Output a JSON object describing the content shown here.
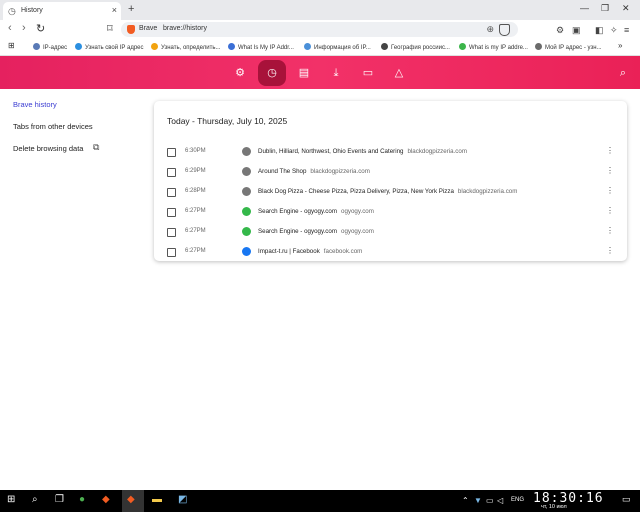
{
  "tab": {
    "title": "History",
    "close": "×",
    "new_tab": "+"
  },
  "window": {
    "minimize": "—",
    "restore": "❐",
    "close": "✕"
  },
  "toolbar": {
    "back": "‹",
    "forward": "›",
    "reload": "↻",
    "bookmark": "⌑",
    "brand": "Brave",
    "url": "brave://history"
  },
  "bookmarks": [
    {
      "label": "IP-адрес",
      "color": "#5a7ab6"
    },
    {
      "label": "Узнать свой IP адрес",
      "color": "#2b8fe0"
    },
    {
      "label": "Узнать, определить...",
      "color": "#f2a30f"
    },
    {
      "label": "What Is My IP Addr...",
      "color": "#3b6fd6"
    },
    {
      "label": "Информация об IP...",
      "color": "#4a90d9"
    },
    {
      "label": "География россиис...",
      "color": "#444444"
    },
    {
      "label": "What is my IP addre...",
      "color": "#3bb54a"
    },
    {
      "label": "Мой IP адрес - узн...",
      "color": "#6b6b6b"
    }
  ],
  "sidebar": {
    "history": "Brave history",
    "tabs_other": "Tabs from other devices",
    "delete": "Delete browsing data"
  },
  "history": {
    "date_heading": "Today - Thursday, July 10, 2025",
    "rows": [
      {
        "time": "6:30PM",
        "title": "Dublin, Hilliard, Northwest, Ohio Events and Catering",
        "domain": "blackdogpizzeria.com",
        "fav": "#777777"
      },
      {
        "time": "6:29PM",
        "title": "Around The Shop",
        "domain": "blackdogpizzeria.com",
        "fav": "#777777"
      },
      {
        "time": "6:28PM",
        "title": "Black Dog Pizza - Cheese Pizza, Pizza Delivery, Pizza, New York Pizza",
        "domain": "blackdogpizzeria.com",
        "fav": "#777777"
      },
      {
        "time": "6:27PM",
        "title": "Search Engine - ogyogy.com",
        "domain": "ogyogy.com",
        "fav": "#34b84a"
      },
      {
        "time": "6:27PM",
        "title": "Search Engine - ogyogy.com",
        "domain": "ogyogy.com",
        "fav": "#34b84a"
      },
      {
        "time": "6:27PM",
        "title": "Impact-t.ru | Facebook",
        "domain": "facebook.com",
        "fav": "#1877f2"
      }
    ]
  },
  "taskbar": {
    "lang": "ENG",
    "time": "18:30:16",
    "date": "чт, 10 июл"
  }
}
